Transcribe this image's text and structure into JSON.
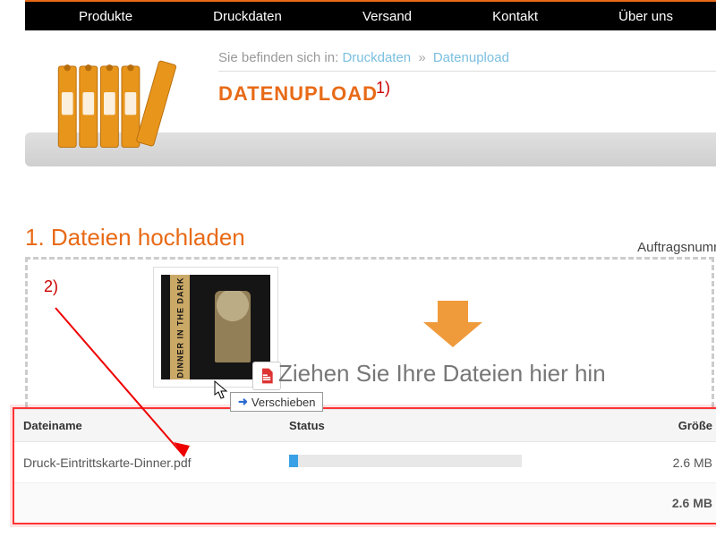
{
  "nav": {
    "items": [
      "Produkte",
      "Druckdaten",
      "Versand",
      "Kontakt",
      "Über uns"
    ]
  },
  "breadcrumb": {
    "prefix": "Sie befinden sich in:",
    "link": "Druckdaten",
    "current": "Datenupload"
  },
  "page_title": "DATENUPLOAD",
  "annotations": {
    "a1": "1)",
    "a2": "2)"
  },
  "section": {
    "title": "1. Dateien hochladen",
    "side_label": "Auftragsnumme"
  },
  "dropzone": {
    "text": "Ziehen Sie Ihre Dateien hier hin",
    "tooltip": "Verschieben",
    "thumb_label": "DINNER IN THE DARK"
  },
  "table": {
    "headers": {
      "name": "Dateiname",
      "status": "Status",
      "size": "Größe"
    },
    "rows": [
      {
        "name": "Druck-Eintrittskarte-Dinner.pdf",
        "progress_pct": 4,
        "size": "2.6 MB"
      }
    ],
    "total_size": "2.6 MB"
  }
}
